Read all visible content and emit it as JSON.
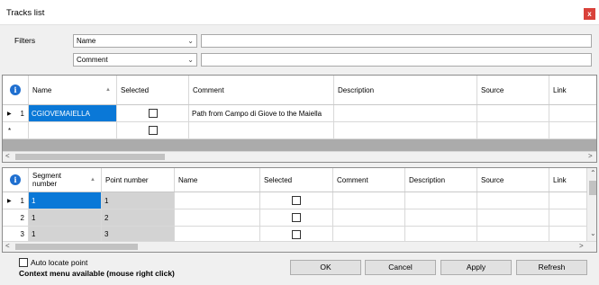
{
  "window": {
    "title": "Tracks list",
    "close_glyph": "x"
  },
  "filters": {
    "label": "Filters",
    "field1": {
      "value": "Name",
      "text": ""
    },
    "field2": {
      "value": "Comment",
      "text": ""
    }
  },
  "tracks_grid": {
    "columns": [
      "Name",
      "Selected",
      "Comment",
      "Description",
      "Source",
      "Link"
    ],
    "rows": [
      {
        "index": "1",
        "name": "CGIOVEMAIELLA",
        "selected": false,
        "comment": "Path from Campo di Giove to the Maiella",
        "description": "",
        "source": "",
        "link": ""
      }
    ],
    "new_row_marker": "*"
  },
  "points_grid": {
    "columns": [
      "Segment number",
      "Point number",
      "Name",
      "Selected",
      "Comment",
      "Description",
      "Source",
      "Link"
    ],
    "rows": [
      {
        "index": "1",
        "segment": "1",
        "point": "1"
      },
      {
        "index": "2",
        "segment": "1",
        "point": "2"
      },
      {
        "index": "3",
        "segment": "1",
        "point": "3"
      }
    ]
  },
  "footer": {
    "auto_locate_label": "Auto locate point",
    "context_hint": "Context menu available (mouse right click)",
    "buttons": {
      "ok": "OK",
      "cancel": "Cancel",
      "apply": "Apply",
      "refresh": "Refresh"
    }
  },
  "icons": {
    "info": "info-icon",
    "dropdown": "chevron-down-icon",
    "current_row": "play-arrow-icon"
  },
  "colors": {
    "selection": "#0a78d7",
    "close_button": "#d9413a",
    "info": "#1f6fd0"
  }
}
